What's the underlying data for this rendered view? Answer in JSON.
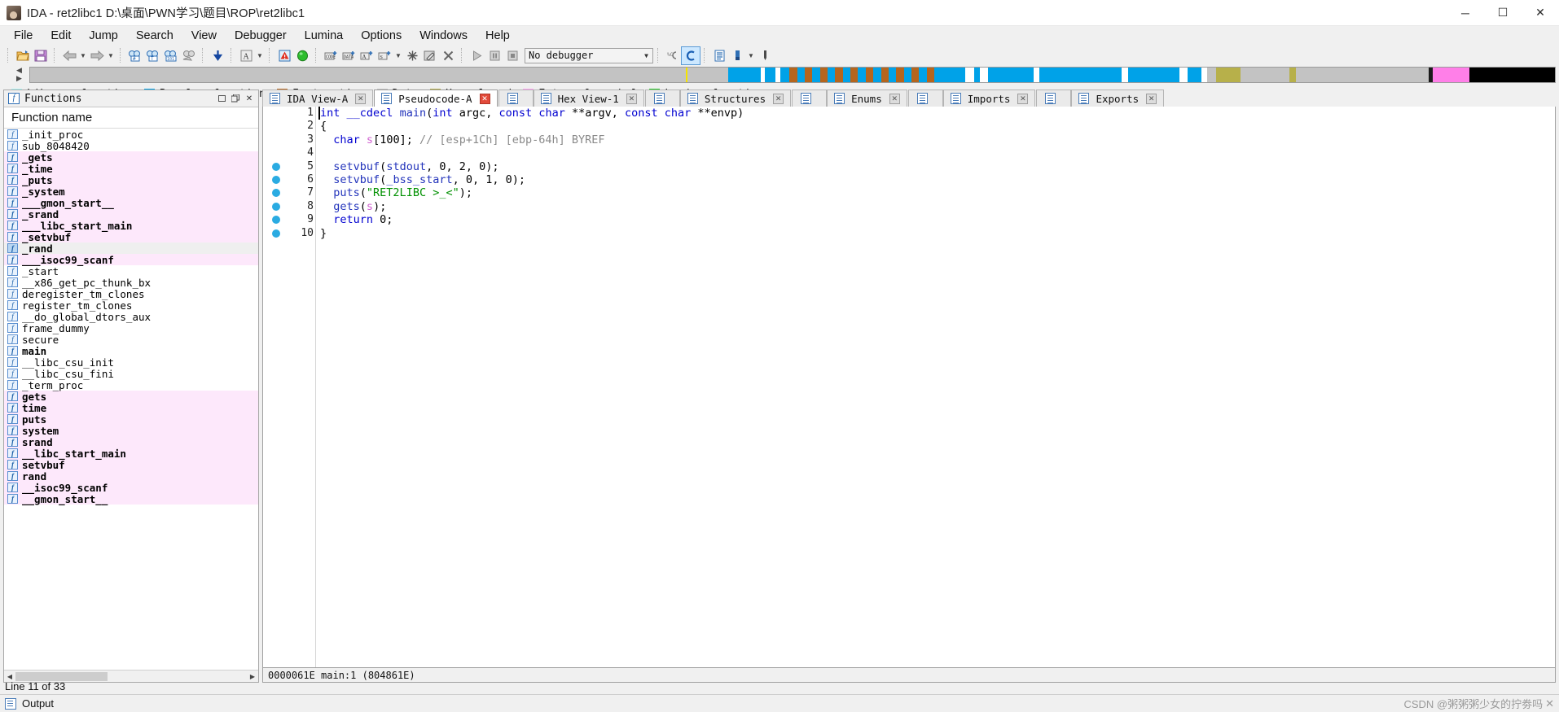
{
  "window": {
    "title": "IDA - ret2libc1 D:\\桌面\\PWN学习\\题目\\ROP\\ret2libc1",
    "app_icon": "ida-logo-icon",
    "minimize": "─",
    "maximize": "☐",
    "close": "✕"
  },
  "menubar": {
    "items": [
      {
        "label": "File",
        "name": "menu-file"
      },
      {
        "label": "Edit",
        "name": "menu-edit"
      },
      {
        "label": "Jump",
        "name": "menu-jump"
      },
      {
        "label": "Search",
        "name": "menu-search"
      },
      {
        "label": "View",
        "name": "menu-view"
      },
      {
        "label": "Debugger",
        "name": "menu-debugger"
      },
      {
        "label": "Lumina",
        "name": "menu-lumina"
      },
      {
        "label": "Options",
        "name": "menu-options"
      },
      {
        "label": "Windows",
        "name": "menu-windows"
      },
      {
        "label": "Help",
        "name": "menu-help"
      }
    ]
  },
  "toolbar": {
    "debugger_selector_value": "No debugger",
    "groups": [
      {
        "buttons": [
          "open-file-icon",
          "save-file-icon"
        ]
      },
      {
        "buttons": [
          "navigate-back-icon",
          "back-dropdown-icon",
          "navigate-forward-icon",
          "forward-dropdown-icon"
        ]
      },
      {
        "buttons": [
          "search-hex-icon",
          "search-text-icon",
          "search-immediate-icon",
          "search-next-icon",
          "jump-down-icon",
          "text-style-icon",
          "text-style-dropdown-icon"
        ]
      },
      {
        "buttons": [
          "warning-icon",
          "green-circle-icon"
        ]
      },
      {
        "buttons": [
          "make-code-icon",
          "make-data-icon",
          "make-ascii-icon",
          "make-struct-icon",
          "struct-dropdown-icon",
          "undefine-icon",
          "edit-function-icon",
          "delete-function-icon"
        ]
      },
      {
        "buttons": [
          "run-icon",
          "pause-icon",
          "stop-icon"
        ]
      },
      {
        "buttons": [
          "decompile-icon",
          "decompile-active-icon"
        ]
      },
      {
        "buttons": [
          "list-view-icon",
          "color-picker-icon",
          "color-dropdown-icon",
          "pipette-icon"
        ]
      }
    ]
  },
  "navband": {
    "left_arrow": "◀",
    "right_arrow": "▶",
    "cursor_position_pct": 43.0,
    "segments": [
      {
        "start_pct": 0.0,
        "width_pct": 45.8,
        "color": "#c3c3c3",
        "kind": "unexplored-gap"
      },
      {
        "start_pct": 45.8,
        "width_pct": 2.1,
        "color": "#00a2e8",
        "kind": "regular-function"
      },
      {
        "start_pct": 47.9,
        "width_pct": 0.3,
        "color": "#ffffff",
        "kind": "divider"
      },
      {
        "start_pct": 48.2,
        "width_pct": 0.7,
        "color": "#00a2e8",
        "kind": "regular-function"
      },
      {
        "start_pct": 48.9,
        "width_pct": 0.3,
        "color": "#ffffff",
        "kind": "divider"
      },
      {
        "start_pct": 49.2,
        "width_pct": 0.6,
        "color": "#00a2e8",
        "kind": "regular-function"
      },
      {
        "start_pct": 49.8,
        "width_pct": 0.5,
        "color": "#b5651d",
        "kind": "instruction"
      },
      {
        "start_pct": 50.3,
        "width_pct": 0.5,
        "color": "#00a2e8",
        "kind": "regular-function"
      },
      {
        "start_pct": 50.8,
        "width_pct": 0.5,
        "color": "#b5651d",
        "kind": "instruction"
      },
      {
        "start_pct": 51.3,
        "width_pct": 0.5,
        "color": "#00a2e8",
        "kind": "regular-function"
      },
      {
        "start_pct": 51.8,
        "width_pct": 0.5,
        "color": "#b5651d",
        "kind": "instruction"
      },
      {
        "start_pct": 52.3,
        "width_pct": 0.5,
        "color": "#00a2e8",
        "kind": "regular-function"
      },
      {
        "start_pct": 52.8,
        "width_pct": 0.5,
        "color": "#b5651d",
        "kind": "instruction"
      },
      {
        "start_pct": 53.3,
        "width_pct": 0.5,
        "color": "#00a2e8",
        "kind": "regular-function"
      },
      {
        "start_pct": 53.8,
        "width_pct": 0.5,
        "color": "#b5651d",
        "kind": "instruction"
      },
      {
        "start_pct": 54.3,
        "width_pct": 0.5,
        "color": "#00a2e8",
        "kind": "regular-function"
      },
      {
        "start_pct": 54.8,
        "width_pct": 0.5,
        "color": "#b5651d",
        "kind": "instruction"
      },
      {
        "start_pct": 55.3,
        "width_pct": 0.5,
        "color": "#00a2e8",
        "kind": "regular-function"
      },
      {
        "start_pct": 55.8,
        "width_pct": 0.5,
        "color": "#b5651d",
        "kind": "instruction"
      },
      {
        "start_pct": 56.3,
        "width_pct": 0.5,
        "color": "#00a2e8",
        "kind": "regular-function"
      },
      {
        "start_pct": 56.8,
        "width_pct": 0.5,
        "color": "#b5651d",
        "kind": "instruction"
      },
      {
        "start_pct": 57.3,
        "width_pct": 0.5,
        "color": "#00a2e8",
        "kind": "regular-function"
      },
      {
        "start_pct": 57.8,
        "width_pct": 0.5,
        "color": "#b5651d",
        "kind": "instruction"
      },
      {
        "start_pct": 58.3,
        "width_pct": 0.5,
        "color": "#00a2e8",
        "kind": "regular-function"
      },
      {
        "start_pct": 58.8,
        "width_pct": 0.5,
        "color": "#b5651d",
        "kind": "instruction"
      },
      {
        "start_pct": 59.3,
        "width_pct": 2.0,
        "color": "#00a2e8",
        "kind": "regular-function"
      },
      {
        "start_pct": 61.3,
        "width_pct": 0.6,
        "color": "#ffffff",
        "kind": "divider"
      },
      {
        "start_pct": 61.9,
        "width_pct": 0.4,
        "color": "#00a2e8",
        "kind": "regular-function"
      },
      {
        "start_pct": 62.3,
        "width_pct": 0.5,
        "color": "#ffffff",
        "kind": "divider"
      },
      {
        "start_pct": 62.8,
        "width_pct": 3.0,
        "color": "#00a2e8",
        "kind": "regular-function"
      },
      {
        "start_pct": 65.8,
        "width_pct": 0.4,
        "color": "#ffffff",
        "kind": "divider"
      },
      {
        "start_pct": 66.2,
        "width_pct": 5.4,
        "color": "#00a2e8",
        "kind": "regular-function"
      },
      {
        "start_pct": 71.6,
        "width_pct": 0.4,
        "color": "#ffffff",
        "kind": "divider"
      },
      {
        "start_pct": 72.0,
        "width_pct": 3.4,
        "color": "#00a2e8",
        "kind": "regular-function"
      },
      {
        "start_pct": 75.4,
        "width_pct": 0.5,
        "color": "#ffffff",
        "kind": "divider"
      },
      {
        "start_pct": 75.9,
        "width_pct": 0.9,
        "color": "#00a2e8",
        "kind": "regular-function"
      },
      {
        "start_pct": 76.8,
        "width_pct": 0.4,
        "color": "#ffffff",
        "kind": "divider"
      },
      {
        "start_pct": 77.2,
        "width_pct": 14.5,
        "color": "#c3c3c3",
        "kind": "data"
      },
      {
        "start_pct": 91.7,
        "width_pct": 0.3,
        "color": "#1a1a1a",
        "kind": "boundary"
      },
      {
        "start_pct": 92.0,
        "width_pct": 2.4,
        "color": "#ff7fe8",
        "kind": "external-symbol"
      },
      {
        "start_pct": 94.4,
        "width_pct": 5.6,
        "color": "#000000",
        "kind": "undefined"
      }
    ],
    "olive_segments": [
      {
        "start_pct": 77.8,
        "width_pct": 1.6,
        "color": "#b7b04a"
      },
      {
        "start_pct": 82.6,
        "width_pct": 0.4,
        "color": "#b7b04a"
      }
    ]
  },
  "legend": {
    "items": [
      {
        "label": "Library function",
        "color": "#aaf7f7",
        "name": "legend-library-function"
      },
      {
        "label": "Regular function",
        "color": "#00a2e8",
        "name": "legend-regular-function"
      },
      {
        "label": "Instruction",
        "color": "#b5651d",
        "name": "legend-instruction"
      },
      {
        "label": "Data",
        "color": "#c3c3c3",
        "name": "legend-data"
      },
      {
        "label": "Unexplored",
        "color": "#b7b04a",
        "name": "legend-unexplored"
      },
      {
        "label": "External symbol",
        "color": "#ff9ff0",
        "name": "legend-external-symbol"
      },
      {
        "label": "Lumina function",
        "color": "#22c822",
        "name": "legend-lumina-function"
      }
    ]
  },
  "functions_panel": {
    "title": "Functions",
    "column_header": "Function name",
    "rows": [
      {
        "name": "_init_proc",
        "style": "normal"
      },
      {
        "name": "sub_8048420",
        "style": "normal"
      },
      {
        "name": "_gets",
        "style": "library"
      },
      {
        "name": "_time",
        "style": "library"
      },
      {
        "name": "_puts",
        "style": "library"
      },
      {
        "name": "_system",
        "style": "library"
      },
      {
        "name": "___gmon_start__",
        "style": "library"
      },
      {
        "name": "_srand",
        "style": "library"
      },
      {
        "name": "___libc_start_main",
        "style": "library"
      },
      {
        "name": "_setvbuf",
        "style": "library"
      },
      {
        "name": "_rand",
        "style": "selected"
      },
      {
        "name": "___isoc99_scanf",
        "style": "library"
      },
      {
        "name": "_start",
        "style": "normal"
      },
      {
        "name": "__x86_get_pc_thunk_bx",
        "style": "normal"
      },
      {
        "name": "deregister_tm_clones",
        "style": "normal"
      },
      {
        "name": "register_tm_clones",
        "style": "normal"
      },
      {
        "name": "__do_global_dtors_aux",
        "style": "normal"
      },
      {
        "name": "frame_dummy",
        "style": "normal"
      },
      {
        "name": "secure",
        "style": "normal"
      },
      {
        "name": "main",
        "style": "bold"
      },
      {
        "name": "__libc_csu_init",
        "style": "normal"
      },
      {
        "name": "__libc_csu_fini",
        "style": "normal"
      },
      {
        "name": "_term_proc",
        "style": "normal"
      },
      {
        "name": "gets",
        "style": "library"
      },
      {
        "name": "time",
        "style": "library"
      },
      {
        "name": "puts",
        "style": "library"
      },
      {
        "name": "system",
        "style": "library"
      },
      {
        "name": "srand",
        "style": "library"
      },
      {
        "name": "__libc_start_main",
        "style": "library"
      },
      {
        "name": "setvbuf",
        "style": "library"
      },
      {
        "name": "rand",
        "style": "library"
      },
      {
        "name": "__isoc99_scanf",
        "style": "library"
      },
      {
        "name": "__gmon_start__",
        "style": "library"
      }
    ],
    "scroll_left_arrow": "◀",
    "scroll_right_arrow": "▶"
  },
  "tabs": [
    {
      "label": "IDA View-A",
      "active": false,
      "closable": true,
      "icon_only": false,
      "name": "tab-ida-view-a"
    },
    {
      "label": "Pseudocode-A",
      "active": true,
      "closable": true,
      "icon_only": false,
      "name": "tab-pseudocode-a"
    },
    {
      "label": "",
      "active": false,
      "closable": false,
      "icon_only": true,
      "name": "tab-hex-view-icon"
    },
    {
      "label": "Hex View-1",
      "active": false,
      "closable": true,
      "icon_only": false,
      "name": "tab-hex-view-1"
    },
    {
      "label": "",
      "active": false,
      "closable": false,
      "icon_only": true,
      "name": "tab-structures-icon"
    },
    {
      "label": "Structures",
      "active": false,
      "closable": true,
      "icon_only": false,
      "name": "tab-structures"
    },
    {
      "label": "",
      "active": false,
      "closable": false,
      "icon_only": true,
      "name": "tab-enums-icon"
    },
    {
      "label": "Enums",
      "active": false,
      "closable": true,
      "icon_only": false,
      "name": "tab-enums"
    },
    {
      "label": "",
      "active": false,
      "closable": false,
      "icon_only": true,
      "name": "tab-imports-icon"
    },
    {
      "label": "Imports",
      "active": false,
      "closable": true,
      "icon_only": false,
      "name": "tab-imports"
    },
    {
      "label": "",
      "active": false,
      "closable": false,
      "icon_only": true,
      "name": "tab-exports-icon"
    },
    {
      "label": "Exports",
      "active": false,
      "closable": true,
      "icon_only": false,
      "name": "tab-exports"
    }
  ],
  "pseudocode": {
    "line_numbers": [
      "1",
      "2",
      "3",
      "4",
      "5",
      "6",
      "7",
      "8",
      "9",
      "10"
    ],
    "breakpoint_lines": [
      5,
      6,
      7,
      8,
      9,
      10
    ],
    "lines": [
      "int __cdecl main(int argc, const char **argv, const char **envp)",
      "{",
      "  char s[100]; // [esp+1Ch] [ebp-64h] BYREF",
      "",
      "  setvbuf(stdout, 0, 2, 0);",
      "  setvbuf(_bss_start, 0, 1, 0);",
      "  puts(\"RET2LIBC >_<\");",
      "  gets(s);",
      "  return 0;",
      "}"
    ]
  },
  "code_status": {
    "address": "0000061E main:1  (804861E)",
    "extra": ""
  },
  "statusbar": {
    "line_info": "Line 11 of 33"
  },
  "output_panel": {
    "label": "Output"
  },
  "watermark": {
    "text": "CSDN @粥粥粥少女的拧劵吗"
  }
}
